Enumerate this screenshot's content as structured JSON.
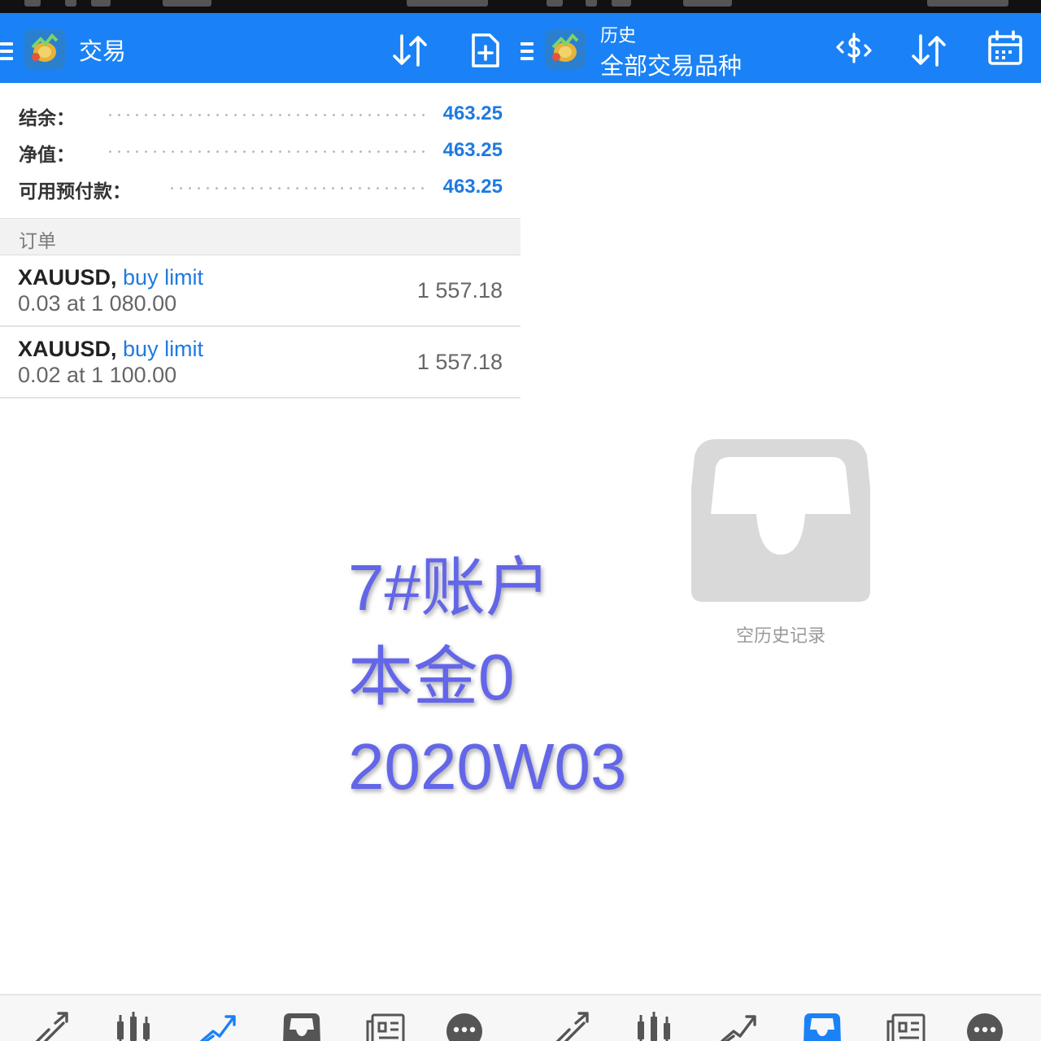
{
  "colors": {
    "accent": "#1a82f6",
    "value_blue": "#1f7ae0",
    "overlay": "#6366e8",
    "empty": "#d9d9d9"
  },
  "left_panel": {
    "app_title": "交易",
    "toolbar_icons": [
      "sort-icon",
      "new-order-icon"
    ],
    "account": [
      {
        "label": "结余：",
        "value": "463.25"
      },
      {
        "label": "净值：",
        "value": "463.25"
      },
      {
        "label": "可用预付款：",
        "value": "463.25"
      }
    ],
    "orders_header": "订单",
    "orders": [
      {
        "symbol": "XAUUSD,",
        "type": "buy limit",
        "details": "0.03 at 1 080.00",
        "price": "1 557.18"
      },
      {
        "symbol": "XAUUSD,",
        "type": "buy limit",
        "details": "0.02 at 1 100.00",
        "price": "1 557.18"
      }
    ]
  },
  "right_panel": {
    "title": "历史",
    "subtitle": "全部交易品种",
    "toolbar_icons": [
      "currency-exchange-icon",
      "sort-icon",
      "calendar-icon"
    ],
    "empty_text": "空历史记录"
  },
  "overlay": {
    "line1": "7#账户",
    "line2": "本金0",
    "line3": "2020W03"
  },
  "bottom_nav": {
    "left": [
      "quotes-icon",
      "chart-icon",
      "trade-icon",
      "history-icon",
      "news-icon",
      "messages-icon"
    ],
    "right": [
      "quotes-icon",
      "chart-icon",
      "trade-icon",
      "history-icon",
      "news-icon",
      "messages-icon"
    ],
    "left_active": "trade-icon",
    "right_active": "history-icon"
  }
}
